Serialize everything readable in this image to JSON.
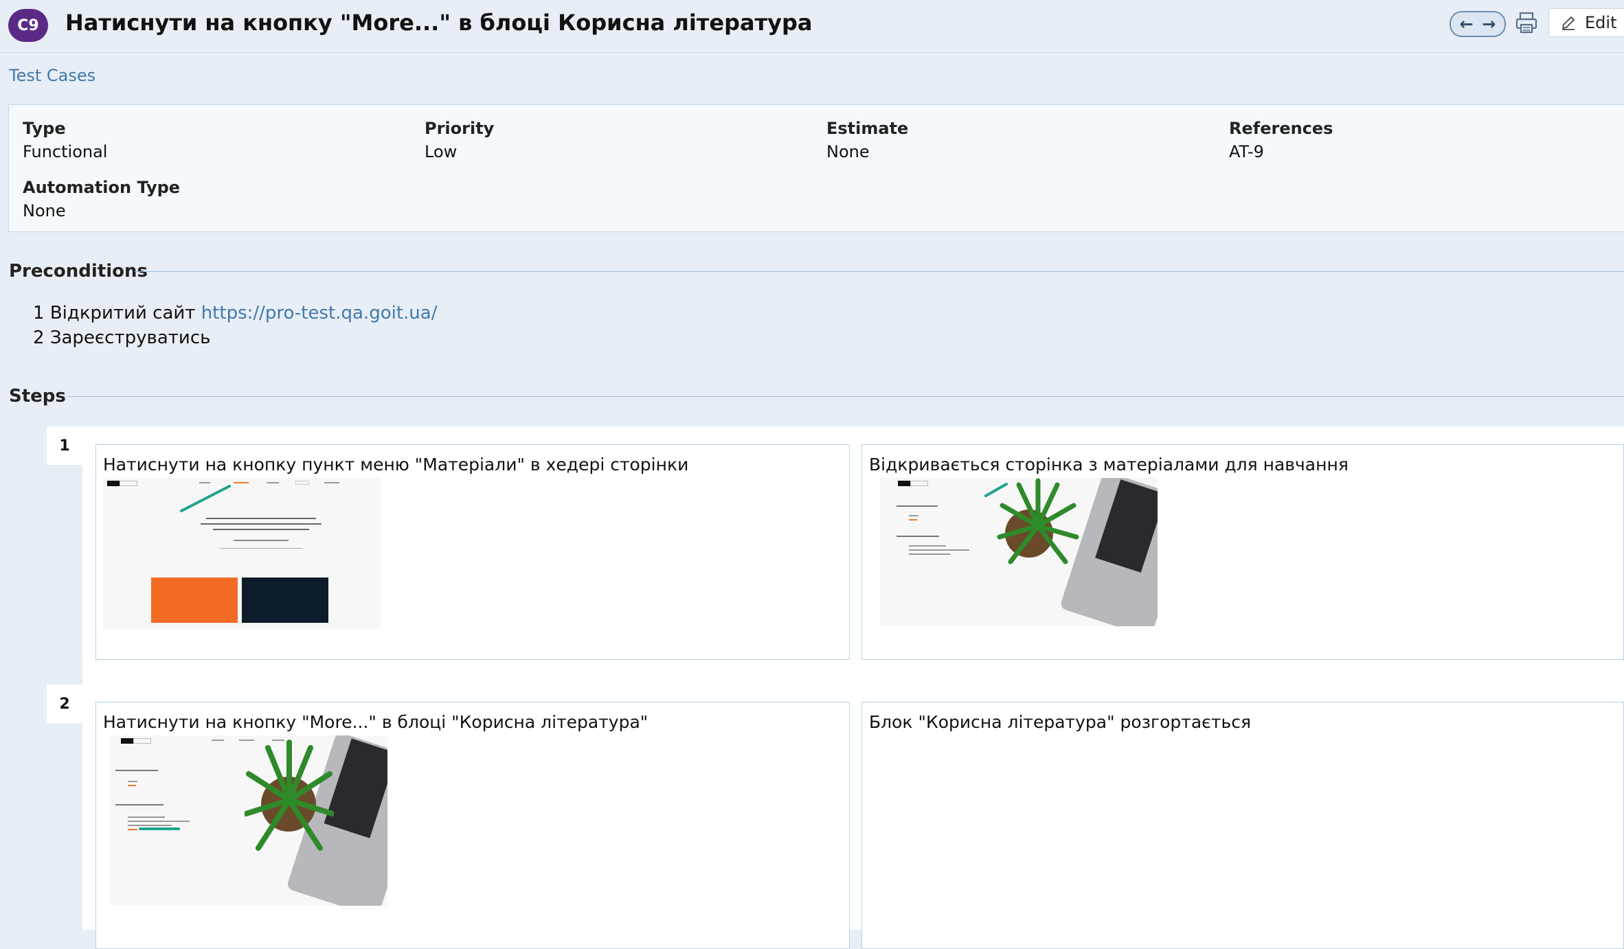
{
  "header": {
    "case_id": "C9",
    "title": "Натиснути на кнопку \"More...\" в блоці Корисна література",
    "edit_label": "Edit"
  },
  "breadcrumb": "Test Cases",
  "fields": {
    "type": {
      "label": "Type",
      "value": "Functional"
    },
    "priority": {
      "label": "Priority",
      "value": "Low"
    },
    "estimate": {
      "label": "Estimate",
      "value": "None"
    },
    "references": {
      "label": "References",
      "value": "AT-9"
    },
    "automation_type": {
      "label": "Automation Type",
      "value": "None"
    }
  },
  "preconditions": {
    "heading": "Preconditions",
    "items": [
      {
        "num": "1",
        "text": "Відкритий сайт",
        "link": "https://pro-test.qa.goit.ua/"
      },
      {
        "num": "2",
        "text": "Зареєструватись"
      }
    ]
  },
  "steps": {
    "heading": "Steps",
    "items": [
      {
        "num": "1",
        "action": "Натиснути на кнопку пункт меню \"Матеріали\" в хедері сторінки",
        "expected": "Відкривається сторінка з матеріалами для навчання"
      },
      {
        "num": "2",
        "action": "Натиснути на кнопку \"More...\" в блоці \"Корисна література\"",
        "expected": "Блок \"Корисна література\" розгортається"
      }
    ]
  },
  "thumb1": {
    "logo": "Pro[Test_]",
    "quote": "\"Регресійне тестування. Що це таке? Якщо система компілюється - це добре, якщо завантажується - чудово!\"",
    "author": "Гічус Торвальдс",
    "btn1": "Теорія тестування",
    "btn2": "QA технічна підготовка"
  },
  "thumb_materials": {
    "res_heading": "Корисні ресурси",
    "lit_heading": "Корисна література"
  }
}
